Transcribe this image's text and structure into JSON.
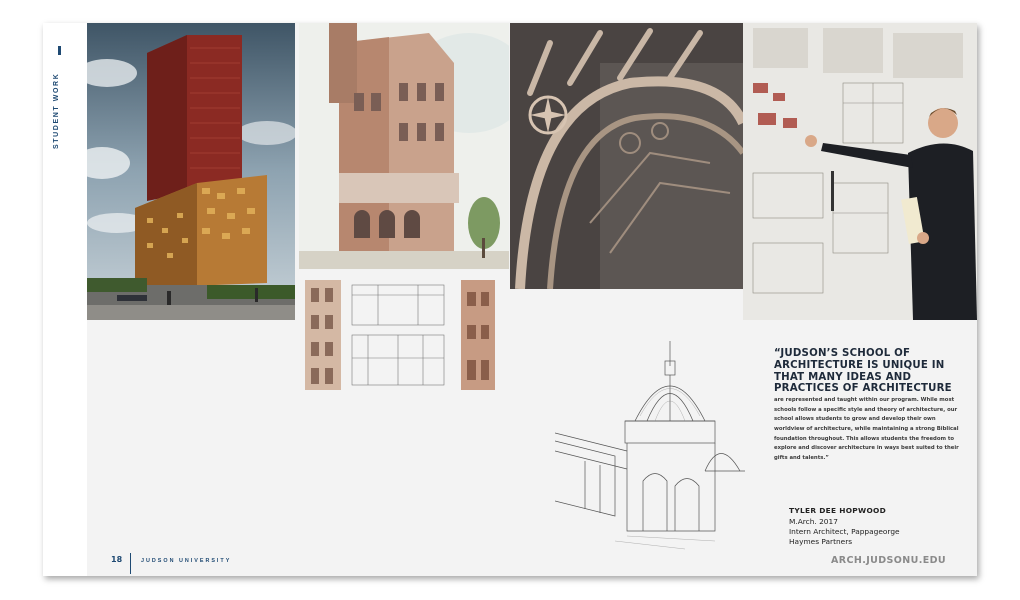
{
  "page": {
    "section_label": "STUDENT WORK",
    "page_number": "18",
    "university": "JUDSON UNIVERSITY",
    "url": "ARCH.JUDSONU.EDU"
  },
  "quote": {
    "headline": "“JUDSON’S SCHOOL OF ARCHITECTURE IS UNIQUE IN THAT MANY IDEAS AND PRACTICES OF ARCHITECTURE",
    "body": "are represented and taught within our program. While most schools follow a specific style and theory of architecture, our school allows students to grow and develop their own worldview of architecture, while maintaining a strong Biblical foundation throughout. This allows students the freedom to explore and discover architecture in ways best suited to their gifts and talents.”"
  },
  "author": {
    "name": "TYLER DEE HOPWOOD",
    "degree": "M.Arch. 2017",
    "role": "Intern Architect, Pappageorge",
    "company": "Haymes Partners"
  },
  "colors": {
    "accent": "#1f4a73",
    "url_gray": "#8a8a8a",
    "page_bg": "#f3f3f3"
  }
}
